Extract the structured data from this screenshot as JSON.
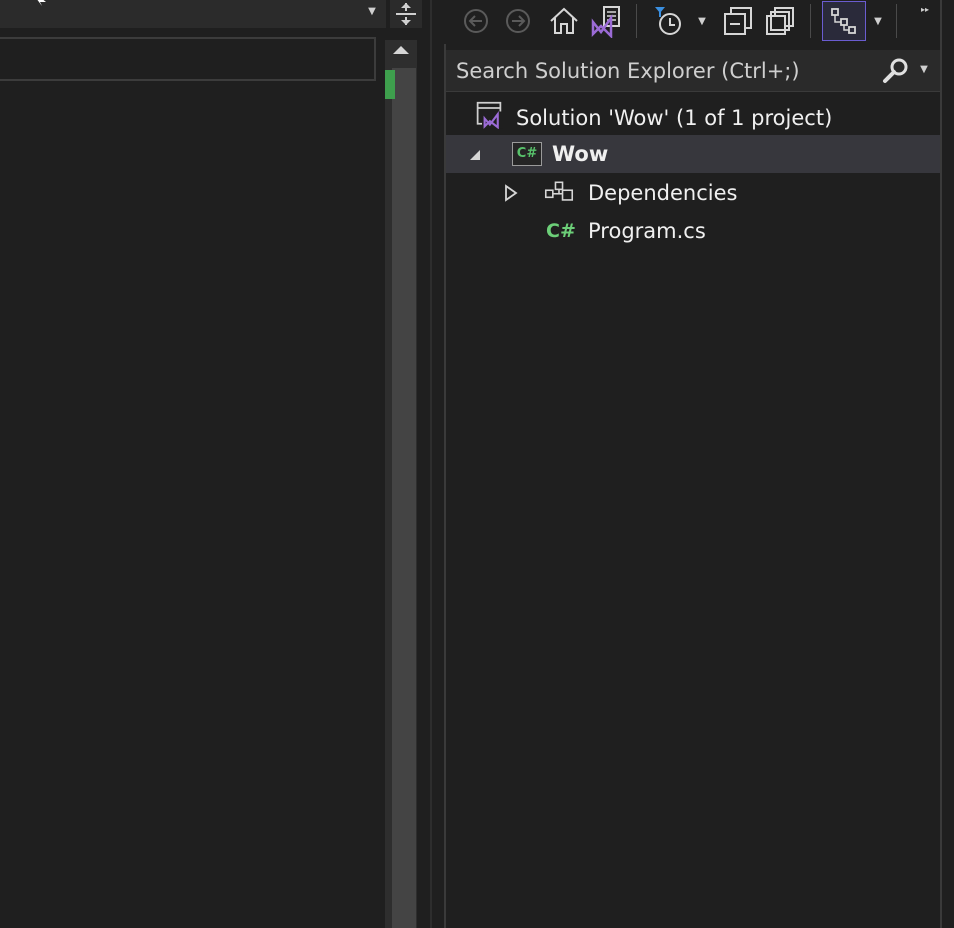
{
  "solution_explorer": {
    "search": {
      "placeholder": "Search Solution Explorer (Ctrl+;)"
    },
    "toolbar": {
      "buttons": [
        {
          "icon": "back-arrow-icon"
        },
        {
          "icon": "forward-arrow-icon"
        },
        {
          "icon": "home-icon"
        },
        {
          "icon": "switch-views-icon"
        },
        {
          "icon": "pending-changes-filter-icon"
        },
        {
          "icon": "collapse-all-icon"
        },
        {
          "icon": "show-all-files-icon"
        },
        {
          "icon": "sync-view-icon"
        }
      ]
    },
    "tree": {
      "solution": "Solution 'Wow' (1 of 1 project)",
      "project": "Wow",
      "dependencies": "Dependencies",
      "file": "Program.cs",
      "cs_glyph": "C#"
    }
  },
  "colors": {
    "background": "#1f1f1f",
    "selection": "#37373d",
    "accent_purple": "#9b6bd6",
    "csharp_green": "#58c26b",
    "scroll_marker": "#3e9f4d"
  }
}
